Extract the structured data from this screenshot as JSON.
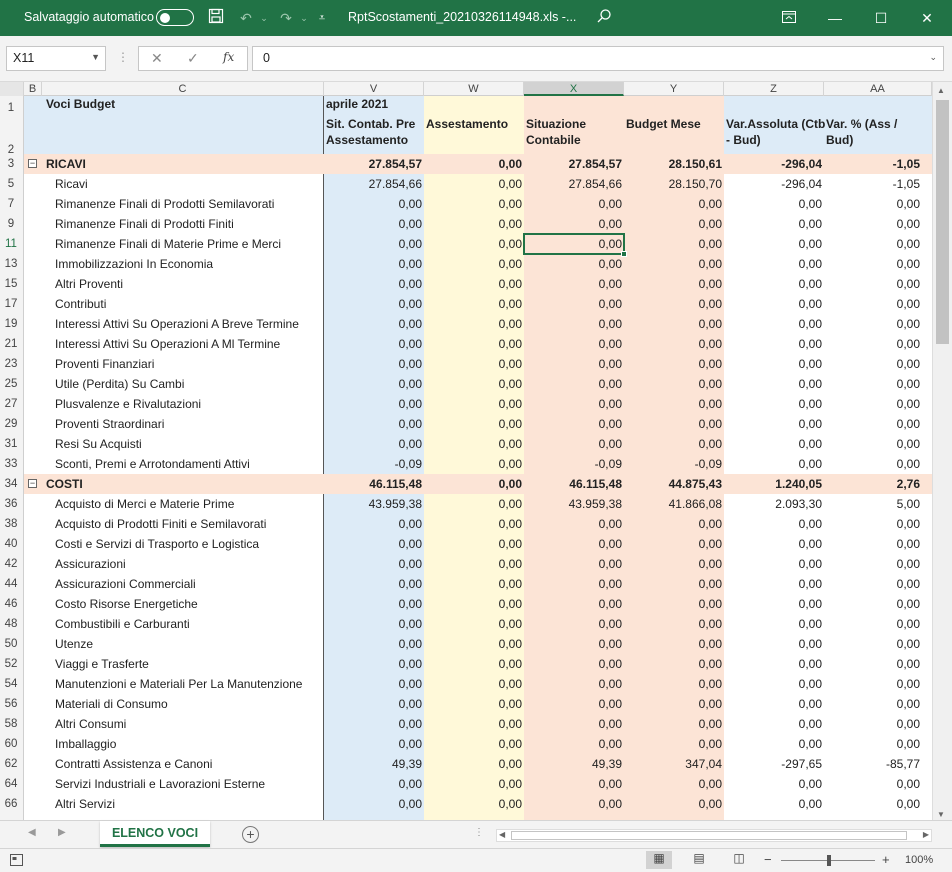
{
  "titlebar": {
    "autosave_label": "Salvataggio automatico",
    "filename": "RptScostamenti_20210326114948.xls  -...",
    "icons": [
      "save-icon",
      "undo-icon",
      "redo-icon",
      "customize-icon",
      "search-icon",
      "ribbon-display-icon",
      "minimize-icon",
      "maximize-icon",
      "close-icon"
    ]
  },
  "formulabar": {
    "namebox": "X11",
    "fx_label": "fx",
    "value": "0"
  },
  "columns": [
    {
      "id": "B",
      "label": "B"
    },
    {
      "id": "C",
      "label": "C"
    },
    {
      "id": "V",
      "label": "V"
    },
    {
      "id": "W",
      "label": "W"
    },
    {
      "id": "X",
      "label": "X"
    },
    {
      "id": "Y",
      "label": "Y"
    },
    {
      "id": "Z",
      "label": "Z"
    },
    {
      "id": "AA",
      "label": "AA"
    }
  ],
  "header": {
    "voci": "Voci Budget",
    "month": "aprile 2021",
    "v1": "Sit. Contab. Pre",
    "v2": "Assestamento",
    "w1": "Assestamento",
    "x1": "Situazione",
    "x2": "Contabile",
    "y1": "Budget Mese",
    "z1": "Var.Assoluta (Ctb",
    "z2": "- Bud)",
    "aa1": "Var. % (Ass /",
    "aa2": "Bud)"
  },
  "rows": [
    {
      "n": "3",
      "group": true,
      "label": "RICAVI",
      "v": "27.854,57",
      "w": "0,00",
      "x": "27.854,57",
      "y": "28.150,61",
      "z": "-296,04",
      "aa": "-1,05"
    },
    {
      "n": "5",
      "label": "Ricavi",
      "v": "27.854,66",
      "w": "0,00",
      "x": "27.854,66",
      "y": "28.150,70",
      "z": "-296,04",
      "aa": "-1,05"
    },
    {
      "n": "7",
      "label": "Rimanenze Finali di Prodotti Semilavorati",
      "v": "0,00",
      "w": "0,00",
      "x": "0,00",
      "y": "0,00",
      "z": "0,00",
      "aa": "0,00"
    },
    {
      "n": "9",
      "label": "Rimanenze Finali di Prodotti Finiti",
      "v": "0,00",
      "w": "0,00",
      "x": "0,00",
      "y": "0,00",
      "z": "0,00",
      "aa": "0,00"
    },
    {
      "n": "11",
      "label": "Rimanenze Finali di Materie Prime e Merci",
      "v": "0,00",
      "w": "0,00",
      "x": "0,00",
      "y": "0,00",
      "z": "0,00",
      "aa": "0,00"
    },
    {
      "n": "13",
      "label": "Immobilizzazioni In Economia",
      "v": "0,00",
      "w": "0,00",
      "x": "0,00",
      "y": "0,00",
      "z": "0,00",
      "aa": "0,00"
    },
    {
      "n": "15",
      "label": "Altri Proventi",
      "v": "0,00",
      "w": "0,00",
      "x": "0,00",
      "y": "0,00",
      "z": "0,00",
      "aa": "0,00"
    },
    {
      "n": "17",
      "label": "Contributi",
      "v": "0,00",
      "w": "0,00",
      "x": "0,00",
      "y": "0,00",
      "z": "0,00",
      "aa": "0,00"
    },
    {
      "n": "19",
      "label": "Interessi Attivi Su Operazioni A Breve Termine",
      "v": "0,00",
      "w": "0,00",
      "x": "0,00",
      "y": "0,00",
      "z": "0,00",
      "aa": "0,00"
    },
    {
      "n": "21",
      "label": "Interessi Attivi Su Operazioni A Ml Termine",
      "v": "0,00",
      "w": "0,00",
      "x": "0,00",
      "y": "0,00",
      "z": "0,00",
      "aa": "0,00"
    },
    {
      "n": "23",
      "label": "Proventi Finanziari",
      "v": "0,00",
      "w": "0,00",
      "x": "0,00",
      "y": "0,00",
      "z": "0,00",
      "aa": "0,00"
    },
    {
      "n": "25",
      "label": "Utile (Perdita) Su Cambi",
      "v": "0,00",
      "w": "0,00",
      "x": "0,00",
      "y": "0,00",
      "z": "0,00",
      "aa": "0,00"
    },
    {
      "n": "27",
      "label": "Plusvalenze e Rivalutazioni",
      "v": "0,00",
      "w": "0,00",
      "x": "0,00",
      "y": "0,00",
      "z": "0,00",
      "aa": "0,00"
    },
    {
      "n": "29",
      "label": "Proventi Straordinari",
      "v": "0,00",
      "w": "0,00",
      "x": "0,00",
      "y": "0,00",
      "z": "0,00",
      "aa": "0,00"
    },
    {
      "n": "31",
      "label": "Resi Su Acquisti",
      "v": "0,00",
      "w": "0,00",
      "x": "0,00",
      "y": "0,00",
      "z": "0,00",
      "aa": "0,00"
    },
    {
      "n": "33",
      "label": "Sconti, Premi e Arrotondamenti  Attivi",
      "v": "-0,09",
      "w": "0,00",
      "x": "-0,09",
      "y": "-0,09",
      "z": "0,00",
      "aa": "0,00"
    },
    {
      "n": "34",
      "group": true,
      "label": "COSTI",
      "v": "46.115,48",
      "w": "0,00",
      "x": "46.115,48",
      "y": "44.875,43",
      "z": "1.240,05",
      "aa": "2,76"
    },
    {
      "n": "36",
      "label": "Acquisto di Merci e Materie Prime",
      "v": "43.959,38",
      "w": "0,00",
      "x": "43.959,38",
      "y": "41.866,08",
      "z": "2.093,30",
      "aa": "5,00"
    },
    {
      "n": "38",
      "label": "Acquisto di Prodotti Finiti e Semilavorati",
      "v": "0,00",
      "w": "0,00",
      "x": "0,00",
      "y": "0,00",
      "z": "0,00",
      "aa": "0,00"
    },
    {
      "n": "40",
      "label": "Costi e Servizi di Trasporto e Logistica",
      "v": "0,00",
      "w": "0,00",
      "x": "0,00",
      "y": "0,00",
      "z": "0,00",
      "aa": "0,00"
    },
    {
      "n": "42",
      "label": "Assicurazioni",
      "v": "0,00",
      "w": "0,00",
      "x": "0,00",
      "y": "0,00",
      "z": "0,00",
      "aa": "0,00"
    },
    {
      "n": "44",
      "label": "Assicurazioni Commerciali",
      "v": "0,00",
      "w": "0,00",
      "x": "0,00",
      "y": "0,00",
      "z": "0,00",
      "aa": "0,00"
    },
    {
      "n": "46",
      "label": "Costo Risorse Energetiche",
      "v": "0,00",
      "w": "0,00",
      "x": "0,00",
      "y": "0,00",
      "z": "0,00",
      "aa": "0,00"
    },
    {
      "n": "48",
      "label": "Combustibili e Carburanti",
      "v": "0,00",
      "w": "0,00",
      "x": "0,00",
      "y": "0,00",
      "z": "0,00",
      "aa": "0,00"
    },
    {
      "n": "50",
      "label": "Utenze",
      "v": "0,00",
      "w": "0,00",
      "x": "0,00",
      "y": "0,00",
      "z": "0,00",
      "aa": "0,00"
    },
    {
      "n": "52",
      "label": "Viaggi e Trasferte",
      "v": "0,00",
      "w": "0,00",
      "x": "0,00",
      "y": "0,00",
      "z": "0,00",
      "aa": "0,00"
    },
    {
      "n": "54",
      "label": "Manutenzioni e Materiali Per La Manutenzione",
      "v": "0,00",
      "w": "0,00",
      "x": "0,00",
      "y": "0,00",
      "z": "0,00",
      "aa": "0,00"
    },
    {
      "n": "56",
      "label": "Materiali di Consumo",
      "v": "0,00",
      "w": "0,00",
      "x": "0,00",
      "y": "0,00",
      "z": "0,00",
      "aa": "0,00"
    },
    {
      "n": "58",
      "label": "Altri Consumi",
      "v": "0,00",
      "w": "0,00",
      "x": "0,00",
      "y": "0,00",
      "z": "0,00",
      "aa": "0,00"
    },
    {
      "n": "60",
      "label": "Imballaggio",
      "v": "0,00",
      "w": "0,00",
      "x": "0,00",
      "y": "0,00",
      "z": "0,00",
      "aa": "0,00"
    },
    {
      "n": "62",
      "label": "Contratti Assistenza e Canoni",
      "v": "49,39",
      "w": "0,00",
      "x": "49,39",
      "y": "347,04",
      "z": "-297,65",
      "aa": "-85,77"
    },
    {
      "n": "64",
      "label": "Servizi Industriali e Lavorazioni Esterne",
      "v": "0,00",
      "w": "0,00",
      "x": "0,00",
      "y": "0,00",
      "z": "0,00",
      "aa": "0,00"
    },
    {
      "n": "66",
      "label": "Altri Servizi",
      "v": "0,00",
      "w": "0,00",
      "x": "0,00",
      "y": "0,00",
      "z": "0,00",
      "aa": "0,00"
    }
  ],
  "sheet": {
    "tab": "ELENCO VOCI"
  },
  "status": {
    "zoom": "100%",
    "zoom_level_percent": 100
  },
  "colors": {
    "accent": "#217346",
    "blue_col": "#ddebf7",
    "yellow_col": "#fff9d9",
    "orange_col": "#fce4d6"
  }
}
